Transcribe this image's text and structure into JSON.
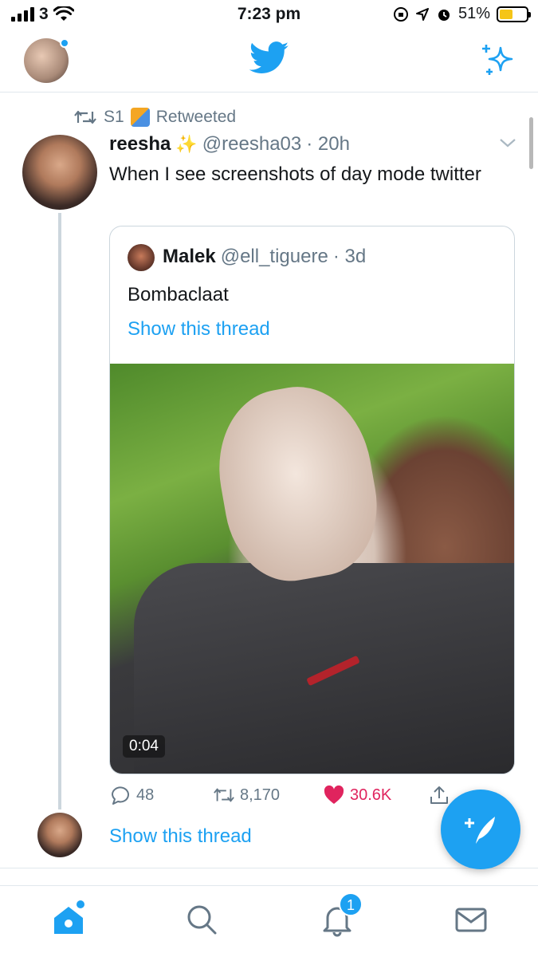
{
  "status_bar": {
    "carrier": "3",
    "time": "7:23 pm",
    "battery": "51%",
    "battery_level": 0.51
  },
  "header": {
    "avatar": "profile-avatar",
    "logo": "twitter-bird-icon",
    "sparkle": "sparkle-icon"
  },
  "tweet": {
    "retweeted_by": "S1",
    "retweeted_label": "Retweeted",
    "author_name": "reesha",
    "author_sparkles": "✨",
    "author_handle": "@reesha03",
    "time": "· 20h",
    "text": "When I see screenshots of day mode twitter",
    "quote": {
      "name": "Malek",
      "handle": "@ell_tiguere",
      "time": "· 3d",
      "text": "Bombaclaat",
      "show_thread": "Show this thread",
      "video_duration": "0:04"
    },
    "actions": {
      "replies": "48",
      "retweets": "8,170",
      "likes": "30.6K"
    },
    "show_thread": "Show this thread"
  },
  "bottom_nav": {
    "notifications_badge": "1"
  },
  "colors": {
    "accent": "#1da1f2",
    "like": "#e0245e",
    "muted": "#657786"
  }
}
